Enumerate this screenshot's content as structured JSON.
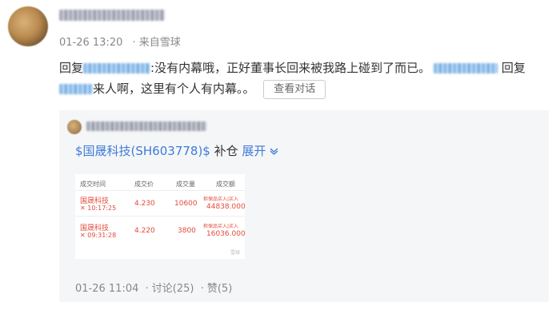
{
  "post": {
    "time": "01-26 13:20",
    "source": "· 来自雪球",
    "reply_prefix": "回复",
    "reply_text_1": ":没有内幕哦，正好董事长回来被我路上碰到了而已。",
    "reply_text_2": "回复",
    "reply_text_3": "来人啊，这里有个人有内幕。。",
    "view_conversation": "查看对话"
  },
  "quote": {
    "stock_link": "$国晟科技(SH603778)$",
    "action": " 补仓 ",
    "expand": "展开",
    "expand_icon": "chevron-down-icon",
    "trade_table": {
      "headers": [
        "成交时间",
        "成交价",
        "成交量",
        "成交额"
      ],
      "rows": [
        {
          "name": "国晟科技",
          "time": "10:17:25",
          "price": "4.230",
          "volume": "10600",
          "note": "担保品买入|买入",
          "amount": "44838.000"
        },
        {
          "name": "国晟科技",
          "time": "09:31:28",
          "price": "4.220",
          "volume": "3800",
          "note": "担保品买入|买入",
          "amount": "16036.000"
        }
      ],
      "watermark": "雪球"
    },
    "footer": {
      "time": "01-26 11:04",
      "comments": "· 讨论(25)",
      "likes": "· 赞(5)"
    }
  },
  "colors": {
    "link": "#3e7bd7",
    "stock_red": "#e24b3c",
    "quote_bg": "#f5f6f8"
  }
}
